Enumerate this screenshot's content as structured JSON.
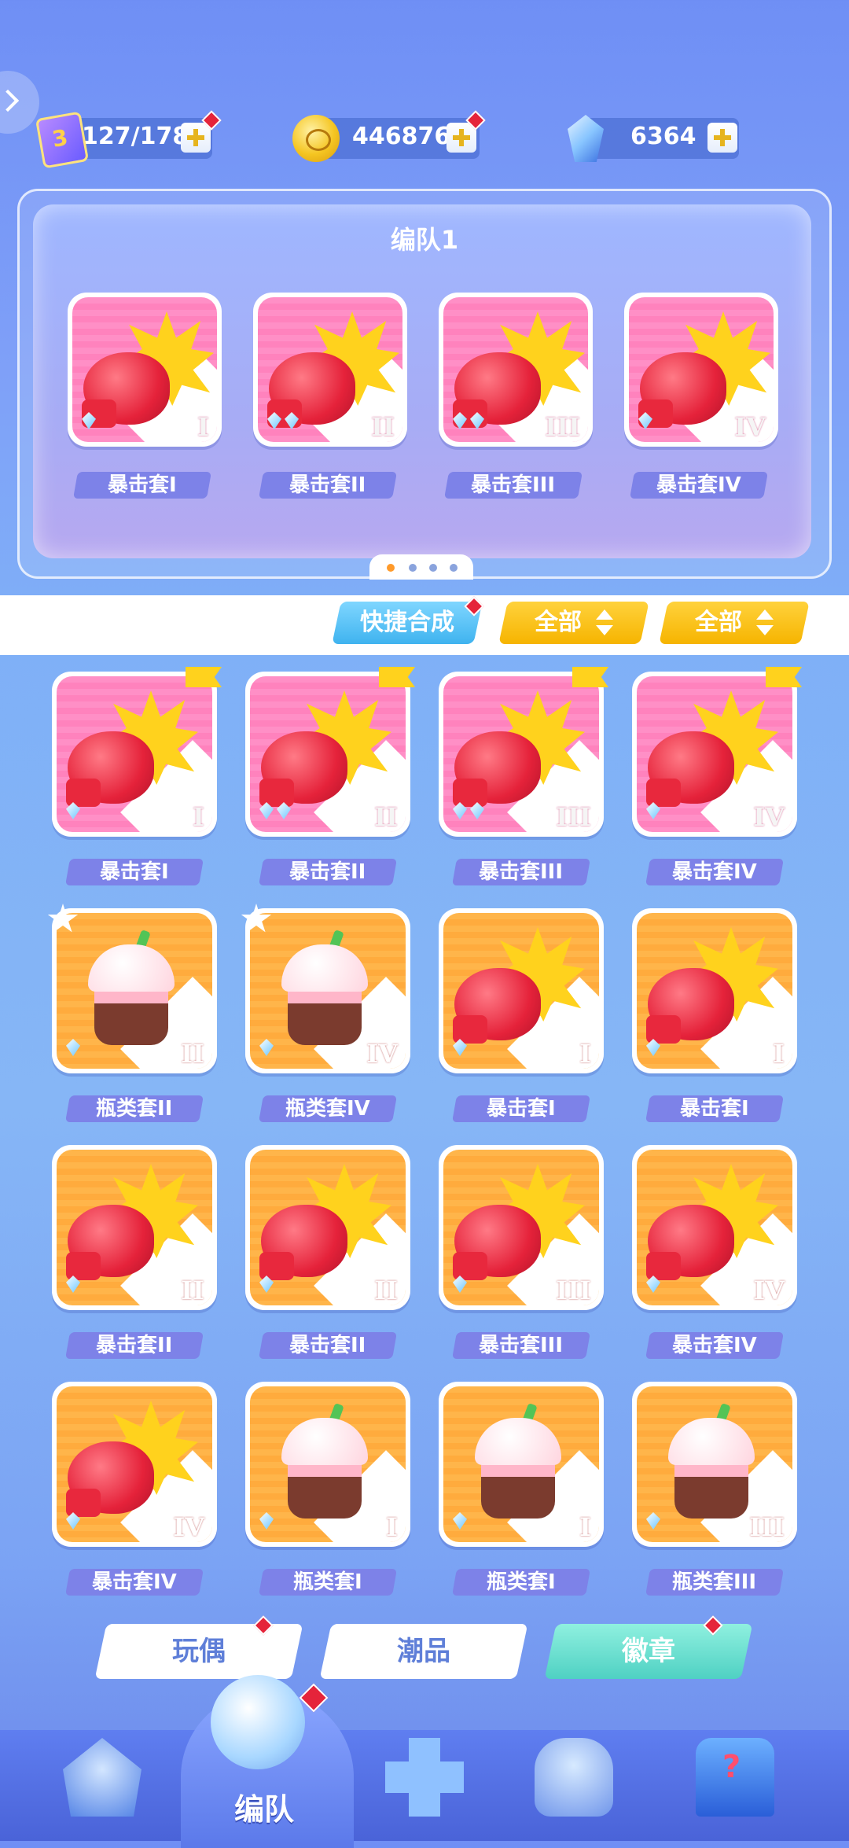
{
  "currencies": [
    {
      "icon": "stamina-ticket-icon",
      "value": "127/178",
      "badge": "3"
    },
    {
      "icon": "gold-coin-icon",
      "value": "446876"
    },
    {
      "icon": "crystal-gem-icon",
      "value": "6364"
    }
  ],
  "team_panel": {
    "title": "编队1",
    "page_index": 1,
    "page_count": 4,
    "slots": [
      {
        "label": "暴击套I",
        "icon": "boxing-glove-icon",
        "roman": "I",
        "gems": 1
      },
      {
        "label": "暴击套II",
        "icon": "boxing-glove-icon",
        "roman": "II",
        "gems": 2
      },
      {
        "label": "暴击套III",
        "icon": "boxing-glove-icon",
        "roman": "III",
        "gems": 2
      },
      {
        "label": "暴击套IV",
        "icon": "boxing-glove-icon",
        "roman": "IV",
        "gems": 1
      }
    ]
  },
  "toolbar": {
    "quick_synth": "快捷合成",
    "filter1": "全部",
    "filter2": "全部"
  },
  "inventory": [
    {
      "label": "暴击套I",
      "icon": "boxing-glove-icon",
      "roman": "I",
      "color": "pink",
      "mark": "flag",
      "gems": 1
    },
    {
      "label": "暴击套II",
      "icon": "boxing-glove-icon",
      "roman": "II",
      "color": "pink",
      "mark": "flag",
      "gems": 2
    },
    {
      "label": "暴击套III",
      "icon": "boxing-glove-icon",
      "roman": "III",
      "color": "pink",
      "mark": "flag",
      "gems": 2
    },
    {
      "label": "暴击套IV",
      "icon": "boxing-glove-icon",
      "roman": "IV",
      "color": "pink",
      "mark": "flag",
      "gems": 1
    },
    {
      "label": "瓶类套II",
      "icon": "milk-tea-cup-icon",
      "roman": "II",
      "color": "orange",
      "mark": "star",
      "gems": 1
    },
    {
      "label": "瓶类套IV",
      "icon": "milk-tea-cup-icon",
      "roman": "IV",
      "color": "orange",
      "mark": "star",
      "gems": 1
    },
    {
      "label": "暴击套I",
      "icon": "boxing-glove-icon",
      "roman": "I",
      "color": "orange",
      "mark": "",
      "gems": 1
    },
    {
      "label": "暴击套I",
      "icon": "boxing-glove-icon",
      "roman": "I",
      "color": "orange",
      "mark": "",
      "gems": 1
    },
    {
      "label": "暴击套II",
      "icon": "boxing-glove-icon",
      "roman": "II",
      "color": "orange",
      "mark": "",
      "gems": 1
    },
    {
      "label": "暴击套II",
      "icon": "boxing-glove-icon",
      "roman": "II",
      "color": "orange",
      "mark": "",
      "gems": 1
    },
    {
      "label": "暴击套III",
      "icon": "boxing-glove-icon",
      "roman": "III",
      "color": "orange",
      "mark": "",
      "gems": 1
    },
    {
      "label": "暴击套IV",
      "icon": "boxing-glove-icon",
      "roman": "IV",
      "color": "orange",
      "mark": "",
      "gems": 1
    },
    {
      "label": "暴击套IV",
      "icon": "boxing-glove-icon",
      "roman": "IV",
      "color": "orange",
      "mark": "",
      "gems": 1
    },
    {
      "label": "瓶类套I",
      "icon": "milk-tea-cup-icon",
      "roman": "I",
      "color": "orange",
      "mark": "",
      "gems": 1
    },
    {
      "label": "瓶类套I",
      "icon": "milk-tea-cup-icon",
      "roman": "I",
      "color": "orange",
      "mark": "",
      "gems": 1
    },
    {
      "label": "瓶类套III",
      "icon": "milk-tea-cup-icon",
      "roman": "III",
      "color": "orange",
      "mark": "",
      "gems": 1
    }
  ],
  "tabs": [
    {
      "label": "玩偶",
      "active": false
    },
    {
      "label": "潮品",
      "active": false
    },
    {
      "label": "徽章",
      "active": true
    }
  ],
  "nav": {
    "active_label": "编队",
    "items": [
      "home-arrow-icon",
      "whistle-icon",
      "puzzle-icon",
      "trophy-icon",
      "gacha-machine-icon"
    ]
  },
  "colors": {
    "accent": "#ffd21d",
    "tab_active": "#4fd1c3",
    "badge_red": "#e5243a"
  }
}
